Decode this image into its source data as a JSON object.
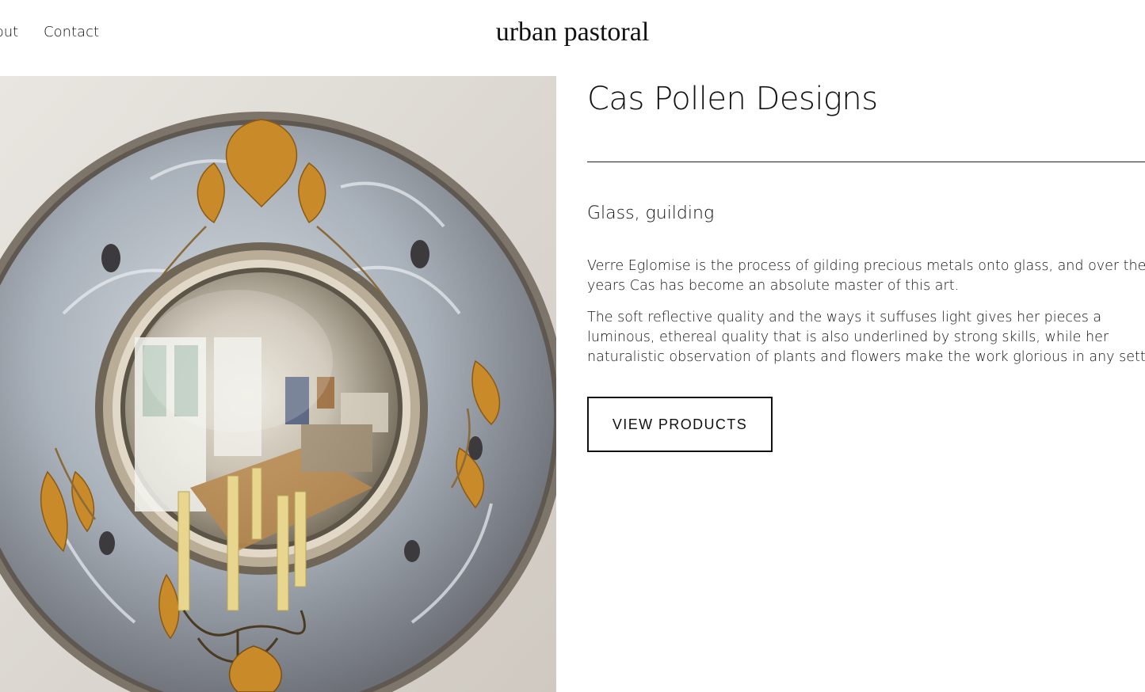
{
  "nav": {
    "about_label": "About",
    "contact_label": "Contact"
  },
  "site": {
    "logo_text": "urban pastoral"
  },
  "hero": {
    "image_name": "convex-mirror-with-gilded-frame"
  },
  "maker": {
    "title": "Cas Pollen Designs",
    "subtitle": "Glass, guilding",
    "paragraphs": [
      "Verre Eglomise is the process of gilding precious metals onto glass, and over the years Cas has become an absolute master of this art.",
      "The soft reflective quality and the ways it suffuses light gives her pieces a luminous, ethereal quality that is also underlined by strong skills, while her naturalistic observation of plants and flowers make the work glorious in any setting."
    ],
    "cta_label": "VIEW PRODUCTS"
  },
  "colors": {
    "text": "#111111",
    "background": "#ffffff",
    "gold": "#c98a2a",
    "silver": "#9aa3ad"
  }
}
